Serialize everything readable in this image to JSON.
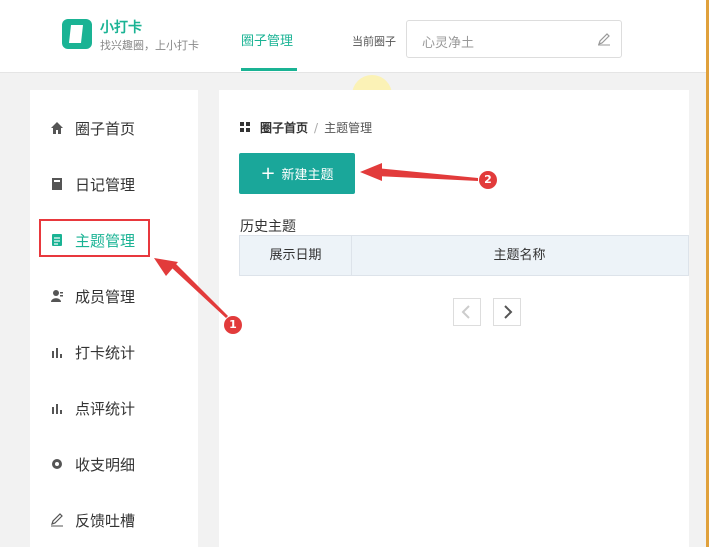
{
  "header": {
    "app_name": "小打卡",
    "tagline": "找兴趣圈，上小打卡",
    "nav_tab": "圈子管理",
    "circle_label": "当前圈子",
    "circle_value": "心灵净土"
  },
  "sidebar": {
    "items": [
      {
        "label": "圈子首页",
        "icon": "home-icon"
      },
      {
        "label": "日记管理",
        "icon": "book-icon"
      },
      {
        "label": "主题管理",
        "icon": "document-icon",
        "active": true
      },
      {
        "label": "成员管理",
        "icon": "member-icon"
      },
      {
        "label": "打卡统计",
        "icon": "bar-chart-icon"
      },
      {
        "label": "点评统计",
        "icon": "bar-chart-icon"
      },
      {
        "label": "收支明细",
        "icon": "gear-icon"
      },
      {
        "label": "反馈吐槽",
        "icon": "pencil-icon"
      }
    ]
  },
  "breadcrumb": {
    "home": "圈子首页",
    "separator": "/",
    "current": "主题管理"
  },
  "main": {
    "new_button": "新建主题",
    "history_title": "历史主题",
    "columns": [
      "展示日期",
      "主题名称"
    ]
  },
  "annotations": {
    "step1": "1",
    "step2": "2"
  },
  "colors": {
    "brand": "#1ab394",
    "button": "#1aa79a",
    "annotation": "#e23b3b"
  }
}
